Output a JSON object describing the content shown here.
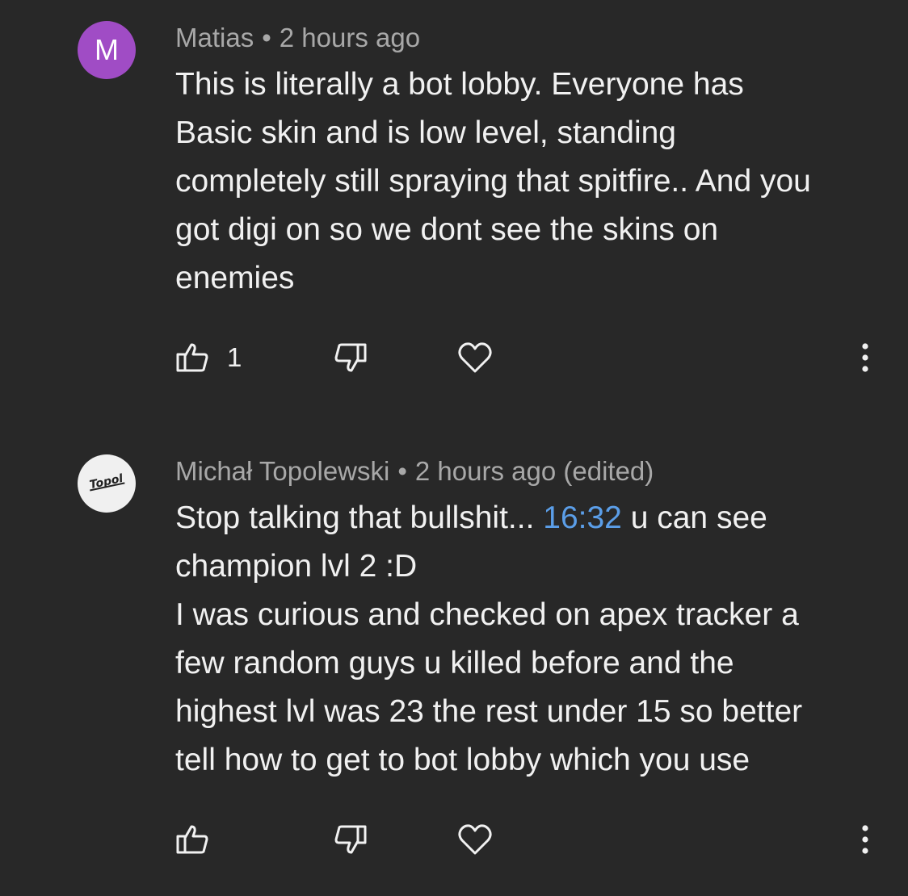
{
  "comments": [
    {
      "author": "Matias",
      "avatar_letter": "M",
      "separator": "•",
      "time": "2 hours ago",
      "lines": [
        "This is literally a bot lobby. Everyone has",
        "Basic skin and is low level, standing",
        "completely still spraying that spitfire.. And you",
        "got digi on so we dont see the skins on",
        "enemies"
      ],
      "like_count": "1",
      "avatar_color": "#a04cc5"
    },
    {
      "author": "Michał Topolewski",
      "avatar_logo_text": "Topol",
      "separator": "•",
      "time": "2 hours ago (edited)",
      "line1_before": "Stop talking that bullshit... ",
      "line1_link": "16:32",
      "line1_after": " u can see",
      "lines": [
        "champion lvl 2 :D",
        "I was curious and checked on apex tracker a",
        "few random guys u killed before and the",
        "highest lvl was 23 the rest under 15 so better",
        "tell how to get to bot lobby which you use"
      ],
      "like_count": ""
    }
  ],
  "colors": {
    "background": "#282828",
    "text": "#f1f1f1",
    "meta": "#a8a8a8",
    "link": "#5b9ee8"
  },
  "icons": {
    "like": "thumb-up-icon",
    "dislike": "thumb-down-icon",
    "heart": "heart-icon",
    "more": "more-vert-icon"
  }
}
